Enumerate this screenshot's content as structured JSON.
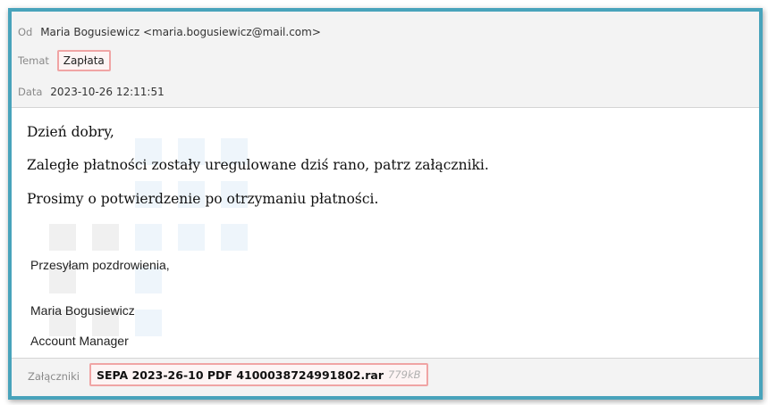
{
  "header": {
    "from_label": "Od",
    "from_value": "Maria Bogusiewicz <maria.bogusiewicz@mail.com>",
    "subject_label": "Temat",
    "subject_value": "Zapłata",
    "date_label": "Data",
    "date_value": "2023-10-26 12:11:51"
  },
  "body": {
    "greeting": "Dzień dobry,",
    "line1": "Zaległe płatności zostały uregulowane dziś rano, patrz załączniki.",
    "line2": "Prosimy o potwierdzenie po otrzymaniu płatności.",
    "closing": "Przesyłam pozdrowienia,",
    "signature_name": "Maria Bogusiewicz",
    "signature_title": "Account Manager"
  },
  "attachments": {
    "label": "Załączniki",
    "items": [
      {
        "name": "SEPA 2023-26-10 PDF 4100038724991802.rar",
        "size": "779kB"
      }
    ]
  },
  "colors": {
    "frame_border": "#48a3bb",
    "highlight_border": "#f0a4a4",
    "header_bg": "#f3f3f3"
  }
}
